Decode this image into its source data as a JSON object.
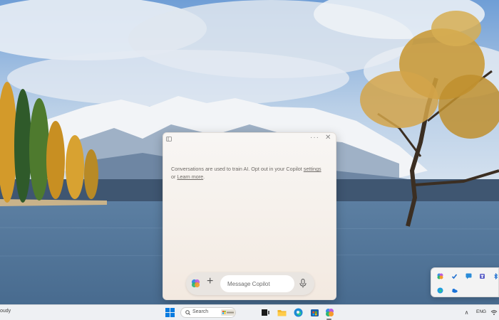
{
  "copilot": {
    "notice_text": "Conversations are used to train AI. Opt out in your Copilot",
    "settings_link": "settings",
    "notice_or": "or",
    "learn_more_link": "Learn more",
    "notice_end": ".",
    "input_placeholder": "Message Copilot",
    "plus_label": "+",
    "more_label": "···",
    "close_label": "✕"
  },
  "taskbar": {
    "weather_label": "oudy",
    "search_label": "Search",
    "language": "ENG",
    "chevron_label": "∧",
    "apps": [
      "start-icon",
      "microsoft-store-icon",
      "task-view-icon",
      "file-explorer-icon",
      "edge-icon",
      "store-icon",
      "copilot-icon"
    ]
  },
  "tray_flyout": {
    "icons": [
      "copilot-tray-icon",
      "check-icon",
      "chat-icon",
      "teams-icon",
      "bluetooth-icon",
      "edge-tray-icon",
      "onedrive-icon"
    ]
  },
  "colors": {
    "accent_blue": "#0078d4",
    "taskbar_bg": "#eef0f3",
    "window_bg": "#f6f1ec"
  }
}
